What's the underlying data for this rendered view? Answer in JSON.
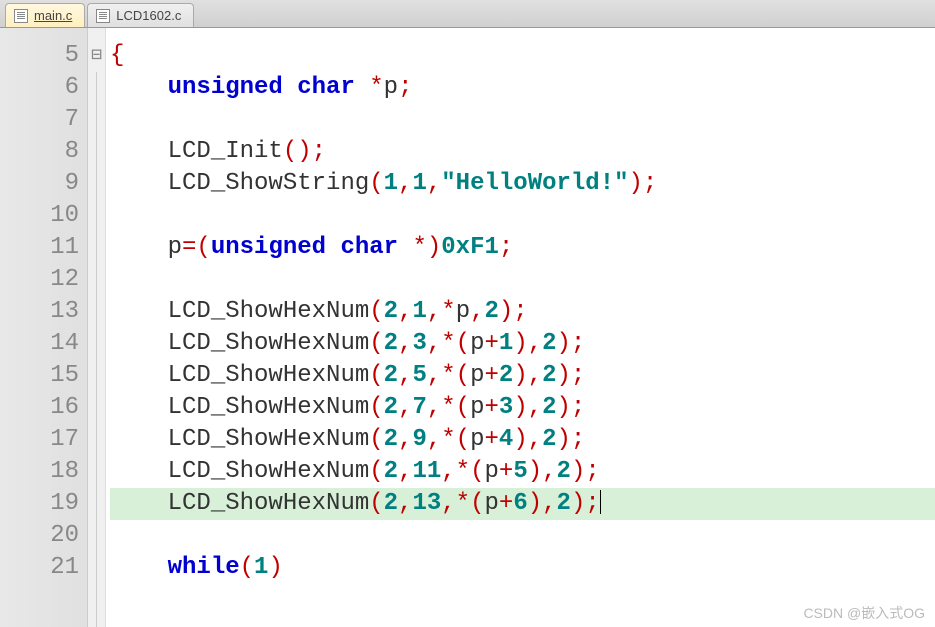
{
  "tabs": [
    {
      "label": "main.c",
      "active": true
    },
    {
      "label": "LCD1602.c",
      "active": false
    }
  ],
  "gutter": {
    "start": 5,
    "end": 21
  },
  "code": {
    "lines": [
      {
        "n": 5,
        "fold": "⊟",
        "segs": [
          {
            "t": "{",
            "c": "punct"
          }
        ]
      },
      {
        "n": 6,
        "segs": [
          {
            "t": "    "
          },
          {
            "t": "unsigned",
            "c": "kw"
          },
          {
            "t": " "
          },
          {
            "t": "char",
            "c": "kw"
          },
          {
            "t": " "
          },
          {
            "t": "*",
            "c": "punct"
          },
          {
            "t": "p"
          },
          {
            "t": ";",
            "c": "punct"
          }
        ]
      },
      {
        "n": 7,
        "segs": []
      },
      {
        "n": 8,
        "segs": [
          {
            "t": "    LCD_Init"
          },
          {
            "t": "();",
            "c": "punct"
          }
        ]
      },
      {
        "n": 9,
        "segs": [
          {
            "t": "    LCD_ShowString"
          },
          {
            "t": "(",
            "c": "punct"
          },
          {
            "t": "1",
            "c": "num"
          },
          {
            "t": ",",
            "c": "punct"
          },
          {
            "t": "1",
            "c": "num"
          },
          {
            "t": ",",
            "c": "punct"
          },
          {
            "t": "\"HelloWorld!\"",
            "c": "str"
          },
          {
            "t": ");",
            "c": "punct"
          }
        ]
      },
      {
        "n": 10,
        "segs": []
      },
      {
        "n": 11,
        "segs": [
          {
            "t": "    p"
          },
          {
            "t": "=(",
            "c": "punct"
          },
          {
            "t": "unsigned",
            "c": "kw"
          },
          {
            "t": " "
          },
          {
            "t": "char",
            "c": "kw"
          },
          {
            "t": " "
          },
          {
            "t": "*)",
            "c": "punct"
          },
          {
            "t": "0xF1",
            "c": "num"
          },
          {
            "t": ";",
            "c": "punct"
          }
        ]
      },
      {
        "n": 12,
        "segs": []
      },
      {
        "n": 13,
        "segs": [
          {
            "t": "    LCD_ShowHexNum"
          },
          {
            "t": "(",
            "c": "punct"
          },
          {
            "t": "2",
            "c": "num"
          },
          {
            "t": ",",
            "c": "punct"
          },
          {
            "t": "1",
            "c": "num"
          },
          {
            "t": ",*",
            "c": "punct"
          },
          {
            "t": "p"
          },
          {
            "t": ",",
            "c": "punct"
          },
          {
            "t": "2",
            "c": "num"
          },
          {
            "t": ");",
            "c": "punct"
          }
        ]
      },
      {
        "n": 14,
        "segs": [
          {
            "t": "    LCD_ShowHexNum"
          },
          {
            "t": "(",
            "c": "punct"
          },
          {
            "t": "2",
            "c": "num"
          },
          {
            "t": ",",
            "c": "punct"
          },
          {
            "t": "3",
            "c": "num"
          },
          {
            "t": ",*(",
            "c": "punct"
          },
          {
            "t": "p"
          },
          {
            "t": "+",
            "c": "punct"
          },
          {
            "t": "1",
            "c": "num"
          },
          {
            "t": "),",
            "c": "punct"
          },
          {
            "t": "2",
            "c": "num"
          },
          {
            "t": ");",
            "c": "punct"
          }
        ]
      },
      {
        "n": 15,
        "segs": [
          {
            "t": "    LCD_ShowHexNum"
          },
          {
            "t": "(",
            "c": "punct"
          },
          {
            "t": "2",
            "c": "num"
          },
          {
            "t": ",",
            "c": "punct"
          },
          {
            "t": "5",
            "c": "num"
          },
          {
            "t": ",*(",
            "c": "punct"
          },
          {
            "t": "p"
          },
          {
            "t": "+",
            "c": "punct"
          },
          {
            "t": "2",
            "c": "num"
          },
          {
            "t": "),",
            "c": "punct"
          },
          {
            "t": "2",
            "c": "num"
          },
          {
            "t": ");",
            "c": "punct"
          }
        ]
      },
      {
        "n": 16,
        "segs": [
          {
            "t": "    LCD_ShowHexNum"
          },
          {
            "t": "(",
            "c": "punct"
          },
          {
            "t": "2",
            "c": "num"
          },
          {
            "t": ",",
            "c": "punct"
          },
          {
            "t": "7",
            "c": "num"
          },
          {
            "t": ",*(",
            "c": "punct"
          },
          {
            "t": "p"
          },
          {
            "t": "+",
            "c": "punct"
          },
          {
            "t": "3",
            "c": "num"
          },
          {
            "t": "),",
            "c": "punct"
          },
          {
            "t": "2",
            "c": "num"
          },
          {
            "t": ");",
            "c": "punct"
          }
        ]
      },
      {
        "n": 17,
        "segs": [
          {
            "t": "    LCD_ShowHexNum"
          },
          {
            "t": "(",
            "c": "punct"
          },
          {
            "t": "2",
            "c": "num"
          },
          {
            "t": ",",
            "c": "punct"
          },
          {
            "t": "9",
            "c": "num"
          },
          {
            "t": ",*(",
            "c": "punct"
          },
          {
            "t": "p"
          },
          {
            "t": "+",
            "c": "punct"
          },
          {
            "t": "4",
            "c": "num"
          },
          {
            "t": "),",
            "c": "punct"
          },
          {
            "t": "2",
            "c": "num"
          },
          {
            "t": ");",
            "c": "punct"
          }
        ]
      },
      {
        "n": 18,
        "segs": [
          {
            "t": "    LCD_ShowHexNum"
          },
          {
            "t": "(",
            "c": "punct"
          },
          {
            "t": "2",
            "c": "num"
          },
          {
            "t": ",",
            "c": "punct"
          },
          {
            "t": "11",
            "c": "num"
          },
          {
            "t": ",*(",
            "c": "punct"
          },
          {
            "t": "p"
          },
          {
            "t": "+",
            "c": "punct"
          },
          {
            "t": "5",
            "c": "num"
          },
          {
            "t": "),",
            "c": "punct"
          },
          {
            "t": "2",
            "c": "num"
          },
          {
            "t": ");",
            "c": "punct"
          }
        ]
      },
      {
        "n": 19,
        "hl": true,
        "cursor": true,
        "segs": [
          {
            "t": "    LCD_ShowHexNum"
          },
          {
            "t": "(",
            "c": "punct"
          },
          {
            "t": "2",
            "c": "num"
          },
          {
            "t": ",",
            "c": "punct"
          },
          {
            "t": "13",
            "c": "num"
          },
          {
            "t": ",*(",
            "c": "punct"
          },
          {
            "t": "p"
          },
          {
            "t": "+",
            "c": "punct"
          },
          {
            "t": "6",
            "c": "num"
          },
          {
            "t": "),",
            "c": "punct"
          },
          {
            "t": "2",
            "c": "num"
          },
          {
            "t": ");",
            "c": "punct"
          }
        ]
      },
      {
        "n": 20,
        "segs": []
      },
      {
        "n": 21,
        "segs": [
          {
            "t": "    "
          },
          {
            "t": "while",
            "c": "kw"
          },
          {
            "t": "(",
            "c": "punct"
          },
          {
            "t": "1",
            "c": "num"
          },
          {
            "t": ")",
            "c": "punct"
          }
        ]
      }
    ]
  },
  "watermark": "CSDN @嵌入式OG"
}
